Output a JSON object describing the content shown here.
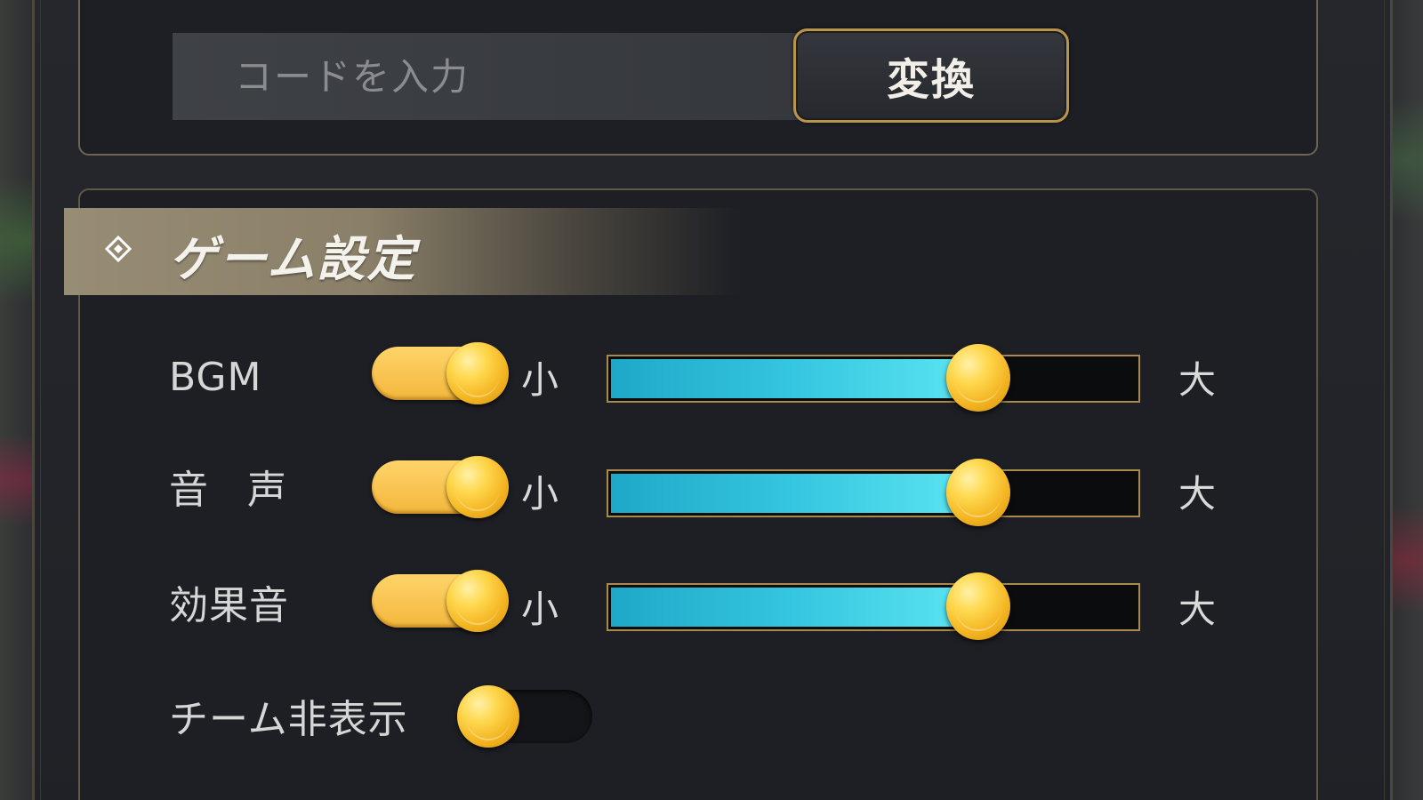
{
  "code_section": {
    "input_placeholder": "コードを入力",
    "input_value": "",
    "convert_label": "変換"
  },
  "settings": {
    "title": "ゲーム設定",
    "rows": [
      {
        "label": "BGM",
        "toggle_on": true,
        "small": "小",
        "large": "大",
        "volume": 0.7
      },
      {
        "label": "音声",
        "toggle_on": true,
        "small": "小",
        "large": "大",
        "volume": 0.7
      },
      {
        "label": "効果音",
        "toggle_on": true,
        "small": "小",
        "large": "大",
        "volume": 0.7
      }
    ],
    "hide_team": {
      "label": "チーム非表示",
      "toggle_on": false
    }
  },
  "colors": {
    "accent_gold": "#f3b73c",
    "slider_fill": "#35c6e0",
    "border_gold": "#b9954c"
  },
  "icons": {
    "section_icon": "diamond-icon"
  }
}
